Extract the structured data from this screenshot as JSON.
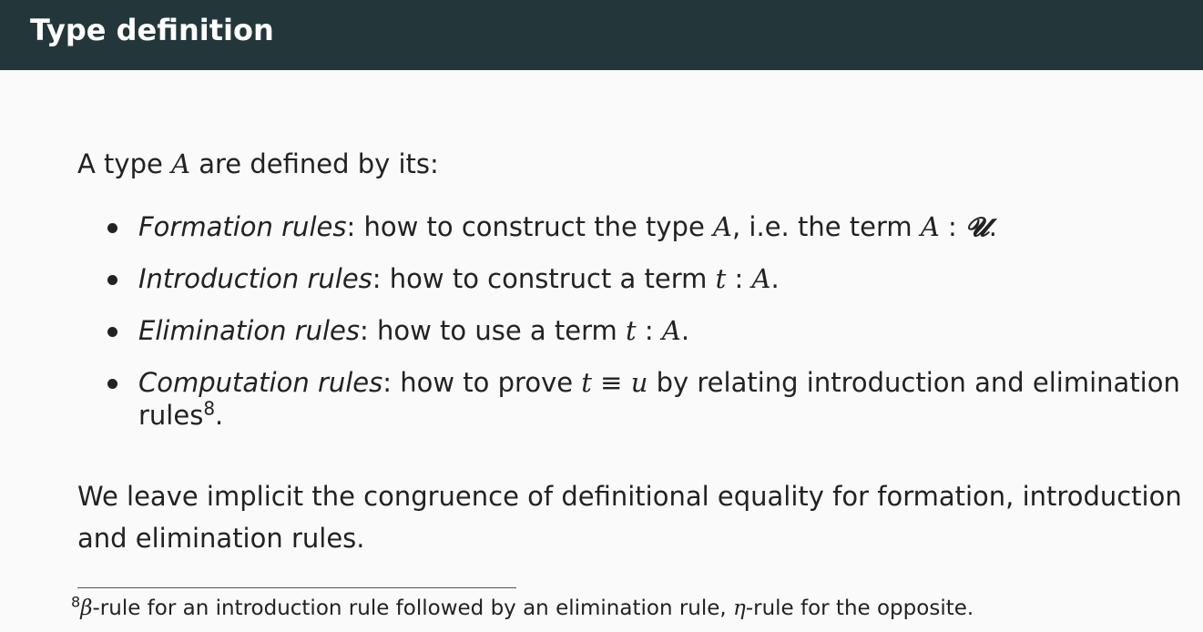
{
  "slide": {
    "title": "Type definition"
  },
  "lead": {
    "prefix": "A type ",
    "var": "A",
    "suffix": " are defined by its:"
  },
  "bullets": [
    {
      "term": "Formation rules",
      "text_pre": ": how to construct the type ",
      "var1": "A",
      "text_mid": ", i.e. the term ",
      "var2": "A",
      "colon": " : ",
      "universe": "𝓤",
      "end": "."
    },
    {
      "term": "Introduction rules",
      "text_pre": ": how to construct a term ",
      "var1": "t",
      "colon": " : ",
      "var2": "A",
      "end": "."
    },
    {
      "term": "Elimination rules",
      "text_pre": ": how to use a term ",
      "var1": "t",
      "colon": " : ",
      "var2": "A",
      "end": "."
    },
    {
      "term": "Computation rules",
      "text_pre": ": how to prove ",
      "var1": "t",
      "equiv": " ≡ ",
      "var2": "u",
      "text_post": " by relating introduction and elimination",
      "line2": "rules",
      "footnote_mark": "8",
      "end": "."
    }
  ],
  "closing": {
    "line1": "We leave implicit the congruence of definitional equality for formation, introduction",
    "line2": "and elimination rules."
  },
  "footnote": {
    "mark": "8",
    "beta": "β",
    "text1": "-rule for an introduction rule followed by an elimination rule, ",
    "eta": "η",
    "text2": "-rule for the opposite."
  }
}
